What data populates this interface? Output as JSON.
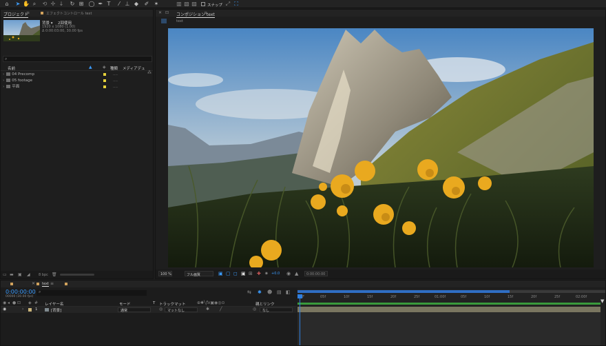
{
  "toolbar": {
    "tools": [
      "home-icon",
      "selection-icon",
      "hand-icon",
      "zoom-icon",
      "orbit-icon",
      "pan-icon",
      "dolly-icon",
      "rotate-icon",
      "rectangle-icon",
      "ellipse-icon",
      "pen-icon",
      "text-icon",
      "brush-icon",
      "clone-stamp-icon",
      "eraser-icon",
      "roto-brush-icon",
      "puppet-icon"
    ],
    "snap_label": "スナップ"
  },
  "project_panel": {
    "tab_label": "プロジェクト",
    "effects_tab_label": "エフェクトコントロール text",
    "thumb_name": "背景 ▾",
    "thumb_usage": "2回使用",
    "thumb_dim": "1920 x 1080 (1.00)",
    "thumb_duration": "Δ 0:00:03:00, 30.00 fps",
    "search_placeholder": "",
    "col_name": "名前",
    "col_type": "種類",
    "col_media": "メディアデュ",
    "items": [
      {
        "name": "04 Precomp",
        "type": "...."
      },
      {
        "name": "05 footage",
        "type": "...."
      },
      {
        "name": "平面",
        "type": "...."
      }
    ],
    "bpc": "8 bpc"
  },
  "composition_panel": {
    "tab_label": "コンポジション text",
    "breadcrumb": "text",
    "zoom": "100 %",
    "resolution": "フル画質",
    "exposure": "+0.0",
    "timecode": "0:00:00:00"
  },
  "timeline": {
    "tab_label": "text",
    "timecode": "0:00:00:00",
    "frame_info": "00000 (30.00 fps)",
    "headers": {
      "layer_name": "レイヤー名",
      "mode": "モード",
      "t": "T",
      "track_matte": "トラックマット",
      "parent": "親とリンク"
    },
    "layers": [
      {
        "num": "1",
        "name": "[背景]",
        "mode": "通常",
        "matte": "マットなし",
        "parent": "なし"
      }
    ],
    "ruler": [
      "0F",
      "05f",
      "10f",
      "15f",
      "20f",
      "25f",
      "01:00f",
      "05f",
      "10f",
      "15f",
      "20f",
      "25f",
      "02:00f"
    ],
    "colors": {
      "accent": "#3b9cff",
      "playhead": "#2f7fe0",
      "work_area": "#3a9a3c",
      "layer_bar": "#7a7660"
    }
  }
}
